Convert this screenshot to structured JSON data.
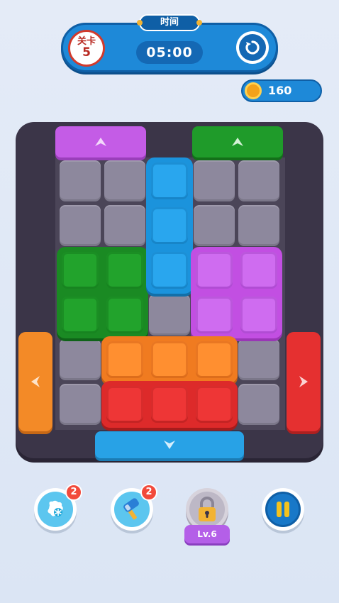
{
  "header": {
    "level_label": "关卡",
    "level_number": "5",
    "time_label": "时间",
    "timer": "05:00",
    "restart_icon": "restart-icon"
  },
  "wallet": {
    "coins": "160",
    "icon": "coin-icon"
  },
  "board": {
    "rows": 6,
    "cols": 5,
    "pieces": [
      {
        "color": "green",
        "hex": "#22a32c",
        "cells": [
          [
            2,
            0
          ],
          [
            2,
            1
          ],
          [
            3,
            0
          ],
          [
            3,
            1
          ]
        ]
      },
      {
        "color": "blue",
        "hex": "#29a6ee",
        "cells": [
          [
            0,
            2
          ],
          [
            1,
            2
          ],
          [
            2,
            2
          ]
        ]
      },
      {
        "color": "purple",
        "hex": "#cf6cf0",
        "cells": [
          [
            2,
            3
          ],
          [
            2,
            4
          ],
          [
            3,
            3
          ],
          [
            3,
            4
          ]
        ]
      },
      {
        "color": "orange",
        "hex": "#ff8f30",
        "cells": [
          [
            4,
            1
          ],
          [
            4,
            2
          ],
          [
            4,
            3
          ]
        ]
      },
      {
        "color": "red",
        "hex": "#ee3636",
        "cells": [
          [
            5,
            1
          ],
          [
            5,
            2
          ],
          [
            5,
            3
          ]
        ]
      }
    ],
    "exits": [
      {
        "side": "top",
        "color": "purple",
        "hex": "#c45ce6",
        "direction": "up"
      },
      {
        "side": "top",
        "color": "green",
        "hex": "#1f9b2a",
        "direction": "up"
      },
      {
        "side": "left",
        "color": "orange",
        "hex": "#f38a27",
        "direction": "left"
      },
      {
        "side": "right",
        "color": "red",
        "hex": "#e53030",
        "direction": "right"
      },
      {
        "side": "bottom",
        "color": "blue",
        "hex": "#28a2e6",
        "direction": "down"
      }
    ]
  },
  "toolbar": {
    "freeze": {
      "icon": "snowflake-freeze-icon",
      "count": "2"
    },
    "hammer": {
      "icon": "hammer-icon",
      "count": "2"
    },
    "locked": {
      "icon": "padlock-icon",
      "label": "Lv.6"
    },
    "pause": {
      "icon": "pause-icon"
    }
  },
  "colors": {
    "hud_blue": "#1e89d8",
    "board_dark": "#3b3548",
    "empty_cell": "#8d889d"
  }
}
